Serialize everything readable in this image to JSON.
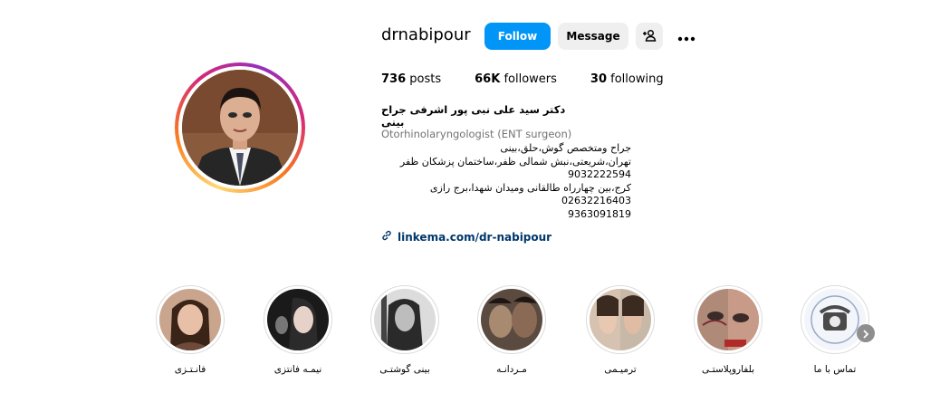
{
  "profile": {
    "username": "drnabipour",
    "follow_label": "Follow",
    "message_label": "Message",
    "add_user_icon": "person-add-icon",
    "more_icon": "more-horizontal-icon",
    "posts_count": "736",
    "posts_label": "posts",
    "followers_count": "66K",
    "followers_label": "followers",
    "following_count": "30",
    "following_label": "following",
    "full_name": "دکتر سید علی نبی پور اشرفی جراح بینی",
    "category": "Otorhinolaryngologist (ENT surgeon)",
    "bio_lines": [
      "جراح ومتخصص گوش،حلق،بینی",
      "تهران،شریعتی،نبش شمالی ظفر،ساختمان پزشکان ظفر",
      "9032222594",
      "کرج،بین چهارراه طالقانی ومیدان شهدا،برج رازی",
      "02632216403",
      "9363091819"
    ],
    "link_text": "linkema.com/dr-nabipour",
    "link_icon": "link-icon"
  },
  "highlights": [
    {
      "label": "فانـتـزی"
    },
    {
      "label": "نیمـه فانتزی"
    },
    {
      "label": "بینی گوشتـی"
    },
    {
      "label": "مـردانـه"
    },
    {
      "label": "ترمیـمی"
    },
    {
      "label": "بلفاروپلاستـی"
    },
    {
      "label": "تماس با ما"
    }
  ],
  "highlights_next_icon": "chevron-right-icon",
  "colors": {
    "follow_button": "#0095f6",
    "secondary_button": "#efefef",
    "link": "#00376b",
    "muted_text": "#737373"
  }
}
